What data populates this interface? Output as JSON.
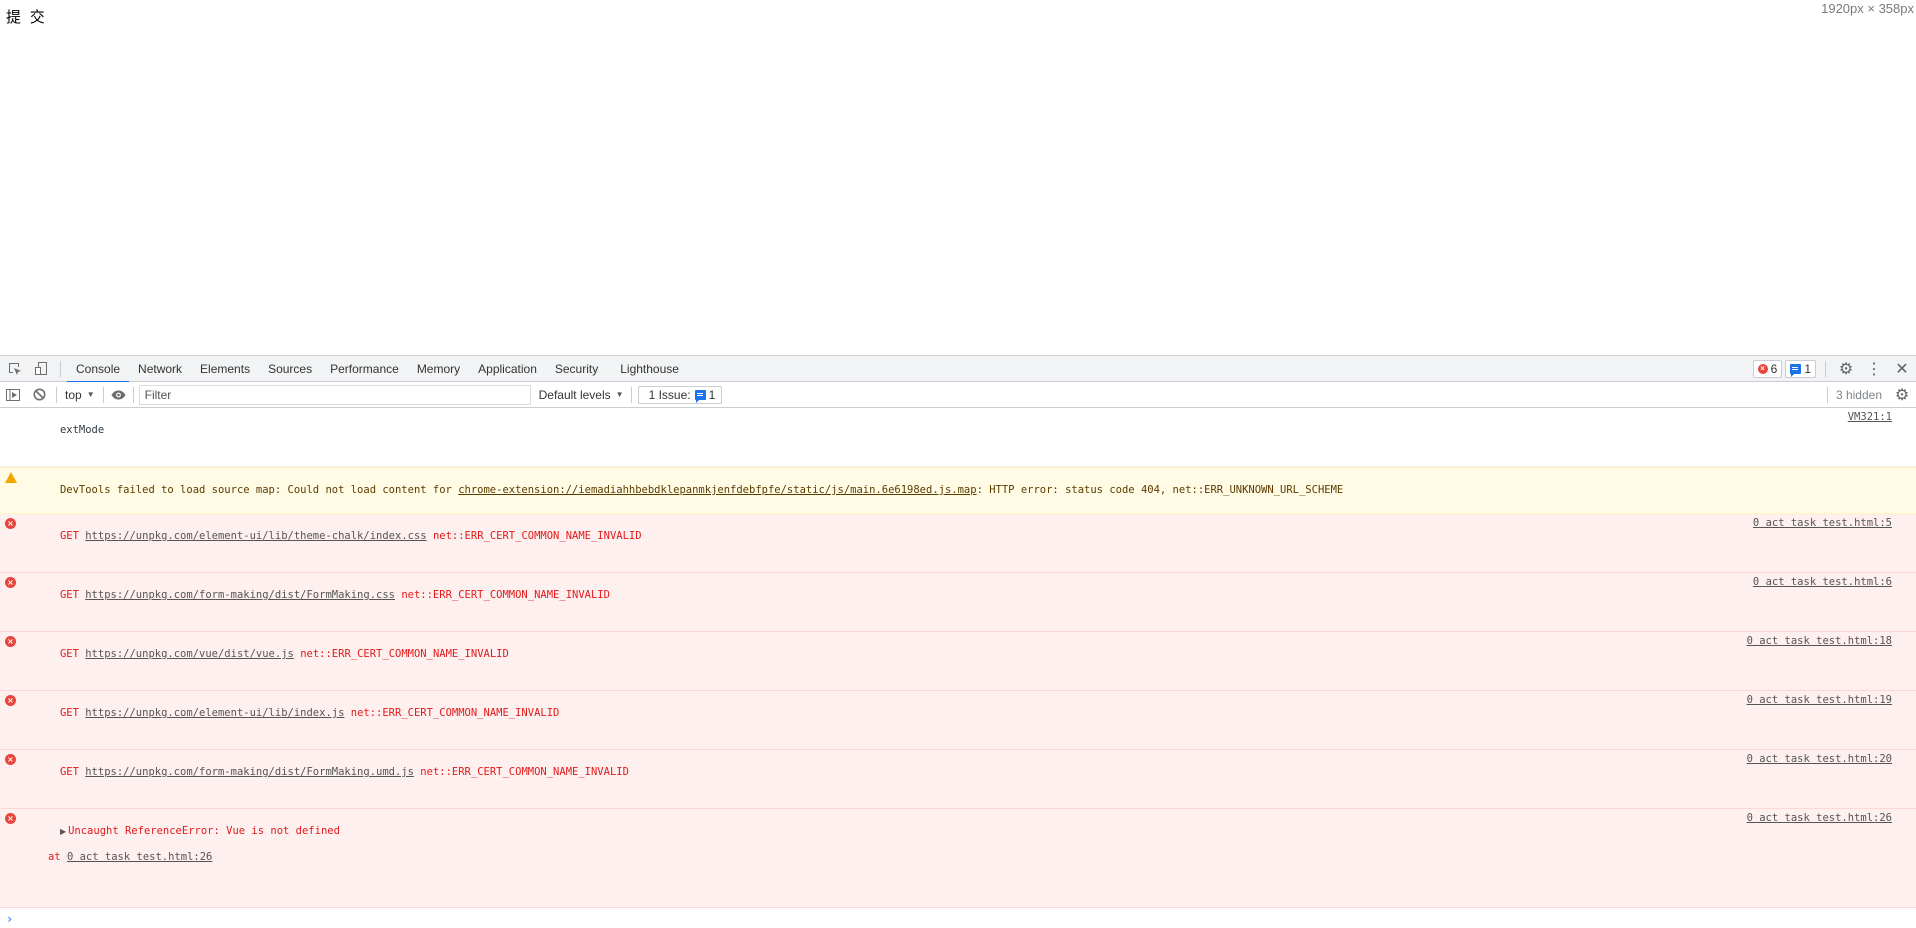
{
  "page": {
    "submit_button": "提 交",
    "viewport_size": "1920px × 358px"
  },
  "devtools": {
    "tabs": [
      {
        "label": "Console",
        "active": true
      },
      {
        "label": "Network"
      },
      {
        "label": "Elements"
      },
      {
        "label": "Sources"
      },
      {
        "label": "Performance"
      },
      {
        "label": "Memory"
      },
      {
        "label": "Application"
      },
      {
        "label": "Security"
      },
      {
        "label": "Lighthouse"
      }
    ],
    "error_count": "6",
    "issue_count_badge": "1",
    "toolbar": {
      "context": "top",
      "filter_placeholder": "Filter",
      "filter_value": "",
      "levels": "Default levels",
      "issues_label": "1 Issue:",
      "issues_count": "1",
      "hidden": "3 hidden"
    },
    "messages": [
      {
        "type": "log",
        "text": "extMode",
        "source": "VM321:1"
      },
      {
        "type": "warn",
        "prefix": "DevTools failed to load source map: Could not load content for ",
        "url": "chrome-extension://iemadiahhbebdklepanmkjenfdebfpfe/static/js/main.6e6198ed.js.map",
        "suffix": ": HTTP error: status code 404, net::ERR_UNKNOWN_URL_SCHEME",
        "source": ""
      },
      {
        "type": "error",
        "method": "GET",
        "url": "https://unpkg.com/element-ui/lib/theme-chalk/index.css",
        "error": "net::ERR_CERT_COMMON_NAME_INVALID",
        "source": "0 act task test.html:5"
      },
      {
        "type": "error",
        "method": "GET",
        "url": "https://unpkg.com/form-making/dist/FormMaking.css",
        "error": "net::ERR_CERT_COMMON_NAME_INVALID",
        "source": "0 act task test.html:6"
      },
      {
        "type": "error",
        "method": "GET",
        "url": "https://unpkg.com/vue/dist/vue.js",
        "error": "net::ERR_CERT_COMMON_NAME_INVALID",
        "source": "0 act task test.html:18"
      },
      {
        "type": "error",
        "method": "GET",
        "url": "https://unpkg.com/element-ui/lib/index.js",
        "error": "net::ERR_CERT_COMMON_NAME_INVALID",
        "source": "0 act task test.html:19"
      },
      {
        "type": "error",
        "method": "GET",
        "url": "https://unpkg.com/form-making/dist/FormMaking.umd.js",
        "error": "net::ERR_CERT_COMMON_NAME_INVALID",
        "source": "0 act task test.html:20"
      },
      {
        "type": "exception",
        "text": "Uncaught ReferenceError: Vue is not defined",
        "stack_prefix": "at ",
        "stack_link": "0 act task test.html:26",
        "source": "0 act task test.html:26"
      }
    ],
    "prompt": "›"
  }
}
